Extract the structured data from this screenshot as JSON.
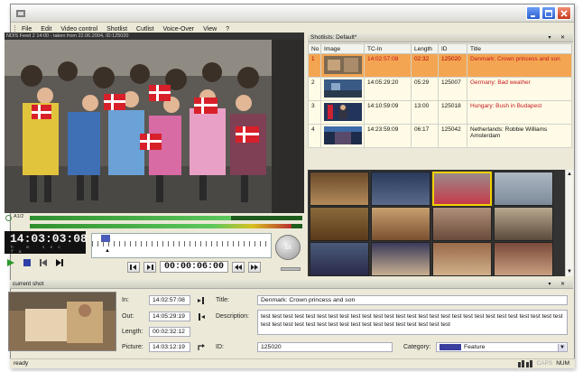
{
  "window": {
    "minimize_icon": "minimize-icon",
    "maximize_icon": "maximize-icon",
    "close_icon": "close-icon"
  },
  "menu": [
    "File",
    "Edit",
    "Video control",
    "Shotlist",
    "Cutlist",
    "Voice-Over",
    "View",
    "?"
  ],
  "video": {
    "overlay_text": "NDIS Feed 2 14:00 - taken from 22.06.2004, ID:125020",
    "audio_label": "A1/2",
    "audio_level_1": 0.74,
    "audio_level_2": 0.96
  },
  "timecode": {
    "main": "14:03:03:08",
    "units": "h m sec fm",
    "position": "00:00:06:00",
    "knob_label": "1x"
  },
  "shotlist": {
    "header": "Shotlists: Default*",
    "columns": [
      "No",
      "Image",
      "TC-In",
      "Length",
      "ID",
      "Title"
    ],
    "rows": [
      {
        "no": "1",
        "tc_in": "14:02:57:08",
        "length": "02:32",
        "id": "125020",
        "title": "Denmark: Crown princess and son",
        "selected": true
      },
      {
        "no": "2",
        "tc_in": "14:05:29:20",
        "length": "05:29",
        "id": "125007",
        "title": "Germany: Bad weather",
        "selected": false
      },
      {
        "no": "3",
        "tc_in": "14:10:59:09",
        "length": "13:00",
        "id": "125018",
        "title": "Hungary: Bush in Budapest",
        "selected": false
      },
      {
        "no": "4",
        "tc_in": "14:23:59:09",
        "length": "06:17",
        "id": "125042",
        "title": "Netherlands: Robbie Williams Amsterdam",
        "selected": false
      }
    ]
  },
  "current_shot": {
    "header": "current shot",
    "in_label": "In:",
    "in_value": "14:02:57:08",
    "out_label": "Out:",
    "out_value": "14:05:29:19",
    "length_label": "Length:",
    "length_value": "00:02:32:12",
    "picture_label": "Picture:",
    "picture_value": "14:03:12:19",
    "title_label": "Title:",
    "title_value": "Denmark: Crown princess and son",
    "description_label": "Description:",
    "description_value": "test test test test test test test test test test test test test test test test test test test test test test test test test test test test test test test test test test test test test test test test test test test test",
    "id_label": "ID:",
    "id_value": "125020",
    "category_label": "Category:",
    "category_value": "Feature",
    "category_color": "#3b3f9e"
  },
  "status": {
    "text": "ready",
    "caps": "CAPS",
    "num": "NUM"
  }
}
